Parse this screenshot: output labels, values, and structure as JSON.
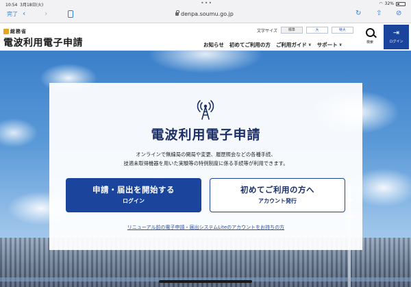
{
  "status_bar": {
    "time": "10:54",
    "date": "3月18日(火)",
    "battery": "32%"
  },
  "browser": {
    "done_label": "完了",
    "url": "denpa.soumu.go.jp",
    "icons": [
      "chevron-back-icon",
      "chevron-forward-icon",
      "tabs-icon",
      "lock-icon",
      "reload-icon",
      "share-icon",
      "compass-icon"
    ]
  },
  "header": {
    "ministry": "総務省",
    "site_title": "電波利用電子申請",
    "font_size_label": "文字サイズ",
    "font_sizes": [
      "標準",
      "大",
      "特大"
    ],
    "nav": [
      {
        "label": "お知らせ",
        "dropdown": false
      },
      {
        "label": "初めてご利用の方",
        "dropdown": false
      },
      {
        "label": "ご利用ガイド",
        "dropdown": true
      },
      {
        "label": "サポート",
        "dropdown": true
      }
    ],
    "search_label": "検索",
    "login_label": "ログイン"
  },
  "hero": {
    "title": "電波利用電子申請",
    "desc_line1": "オンラインで無線局の開局や変更、履歴照会などの各種手続、",
    "desc_line2": "技適未取得機器を用いた実験等の特例制度に係る手続等が利用できます。",
    "primary_button": {
      "main": "申請・届出を開始する",
      "sub": "ログイン"
    },
    "secondary_button": {
      "main": "初めてご利用の方へ",
      "sub": "アカウント発行"
    },
    "legacy_link": "リニューアル前の電子申請・届出システムLiteのアカウントをお持ちの方"
  },
  "colors": {
    "brand_navy": "#1b449c",
    "title_navy": "#1b2f66",
    "logo_orange": "#e8a320",
    "link_blue": "#2c4fa8",
    "safari_blue": "#2f7ce0"
  }
}
